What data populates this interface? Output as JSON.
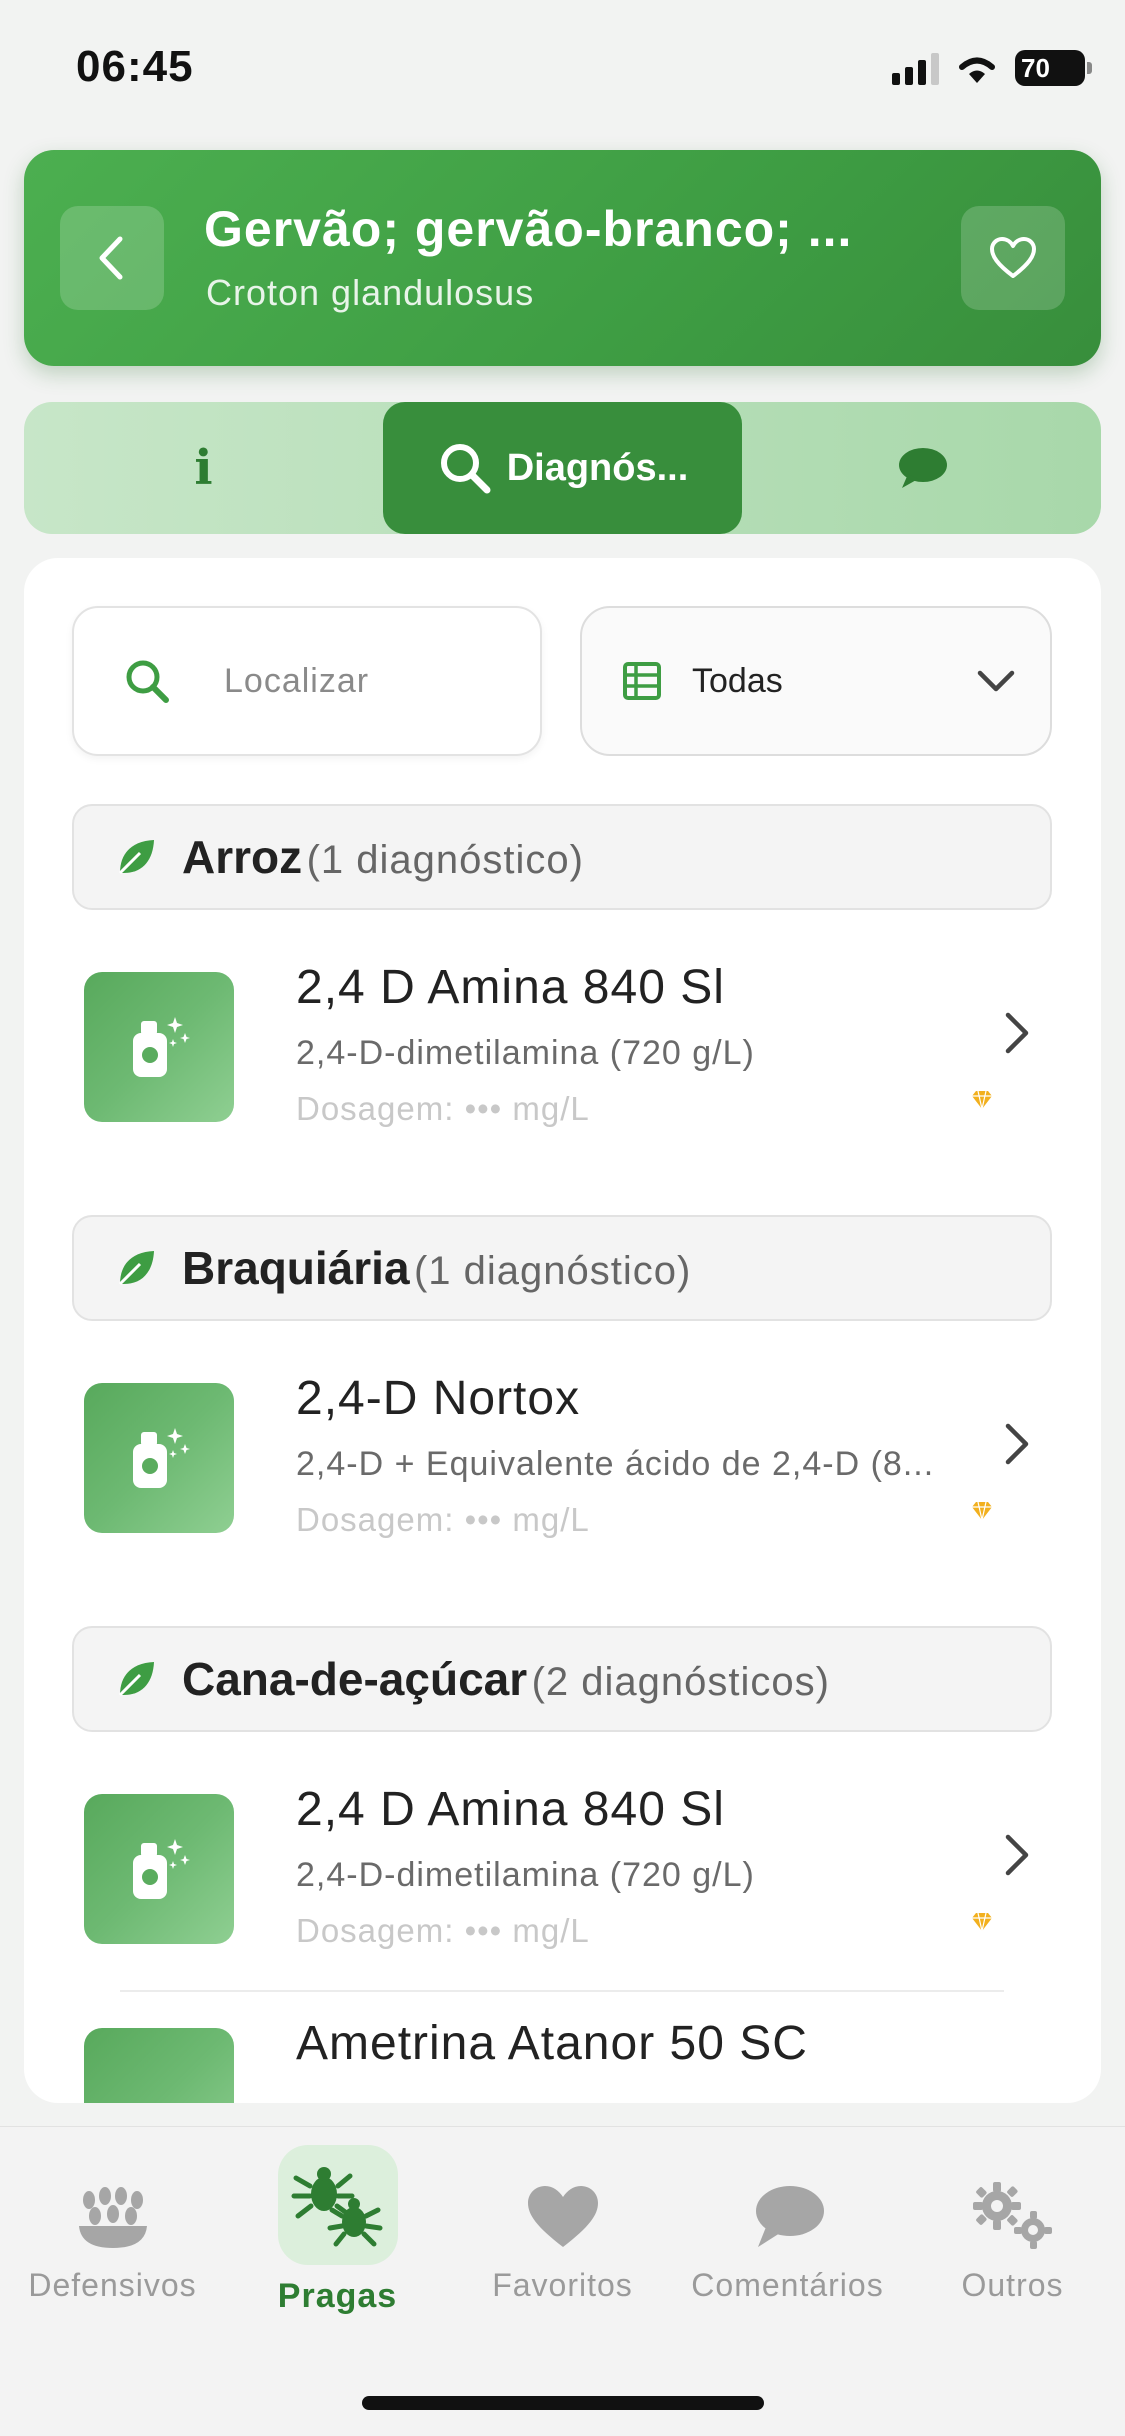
{
  "status_bar": {
    "time": "06:45",
    "battery": "70"
  },
  "header": {
    "title": "Gervão; gervão-branco; ...",
    "subtitle": "Croton glandulosus",
    "back_icon": "chevron-left-icon",
    "favorite_icon": "heart-outline-icon"
  },
  "tabs": [
    {
      "icon": "info-icon",
      "glyph": "i",
      "label": ""
    },
    {
      "icon": "search-icon",
      "label": "Diagnós..."
    },
    {
      "icon": "chat-bubble-icon",
      "label": ""
    }
  ],
  "search": {
    "placeholder": "Localizar",
    "value": ""
  },
  "filter": {
    "selected": "Todas",
    "icon": "table-list-icon"
  },
  "groups": [
    {
      "name": "Arroz",
      "count": "(1 diagnóstico)",
      "items": [
        {
          "name": "2,4 D Amina 840 Sl",
          "ingredient": "2,4-D-dimetilamina (720 g/L)",
          "dosage": "Dosagem: ••• mg/L"
        }
      ]
    },
    {
      "name": "Braquiária",
      "count": "(1 diagnóstico)",
      "items": [
        {
          "name": "2,4-D Nortox",
          "ingredient": "2,4-D + Equivalente ácido de 2,4-D (8...",
          "dosage": "Dosagem: ••• mg/L"
        }
      ]
    },
    {
      "name": "Cana-de-açúcar",
      "count": "(2 diagnósticos)",
      "items": [
        {
          "name": "2,4 D Amina 840 Sl",
          "ingredient": "2,4-D-dimetilamina (720 g/L)",
          "dosage": "Dosagem: ••• mg/L"
        },
        {
          "name": "Ametrina Atanor 50 SC",
          "ingredient": "",
          "dosage": ""
        }
      ]
    }
  ],
  "bottom_nav": [
    {
      "label": "Defensivos",
      "icon": "grain-icon"
    },
    {
      "label": "Pragas",
      "icon": "bugs-icon",
      "active": true
    },
    {
      "label": "Favoritos",
      "icon": "heart-icon"
    },
    {
      "label": "Comentários",
      "icon": "chat-bubble-icon"
    },
    {
      "label": "Outros",
      "icon": "gears-icon"
    }
  ],
  "colors": {
    "primary": "#388e3c",
    "accent_light": "#a8d8aa",
    "premium": "#f2b01e"
  }
}
